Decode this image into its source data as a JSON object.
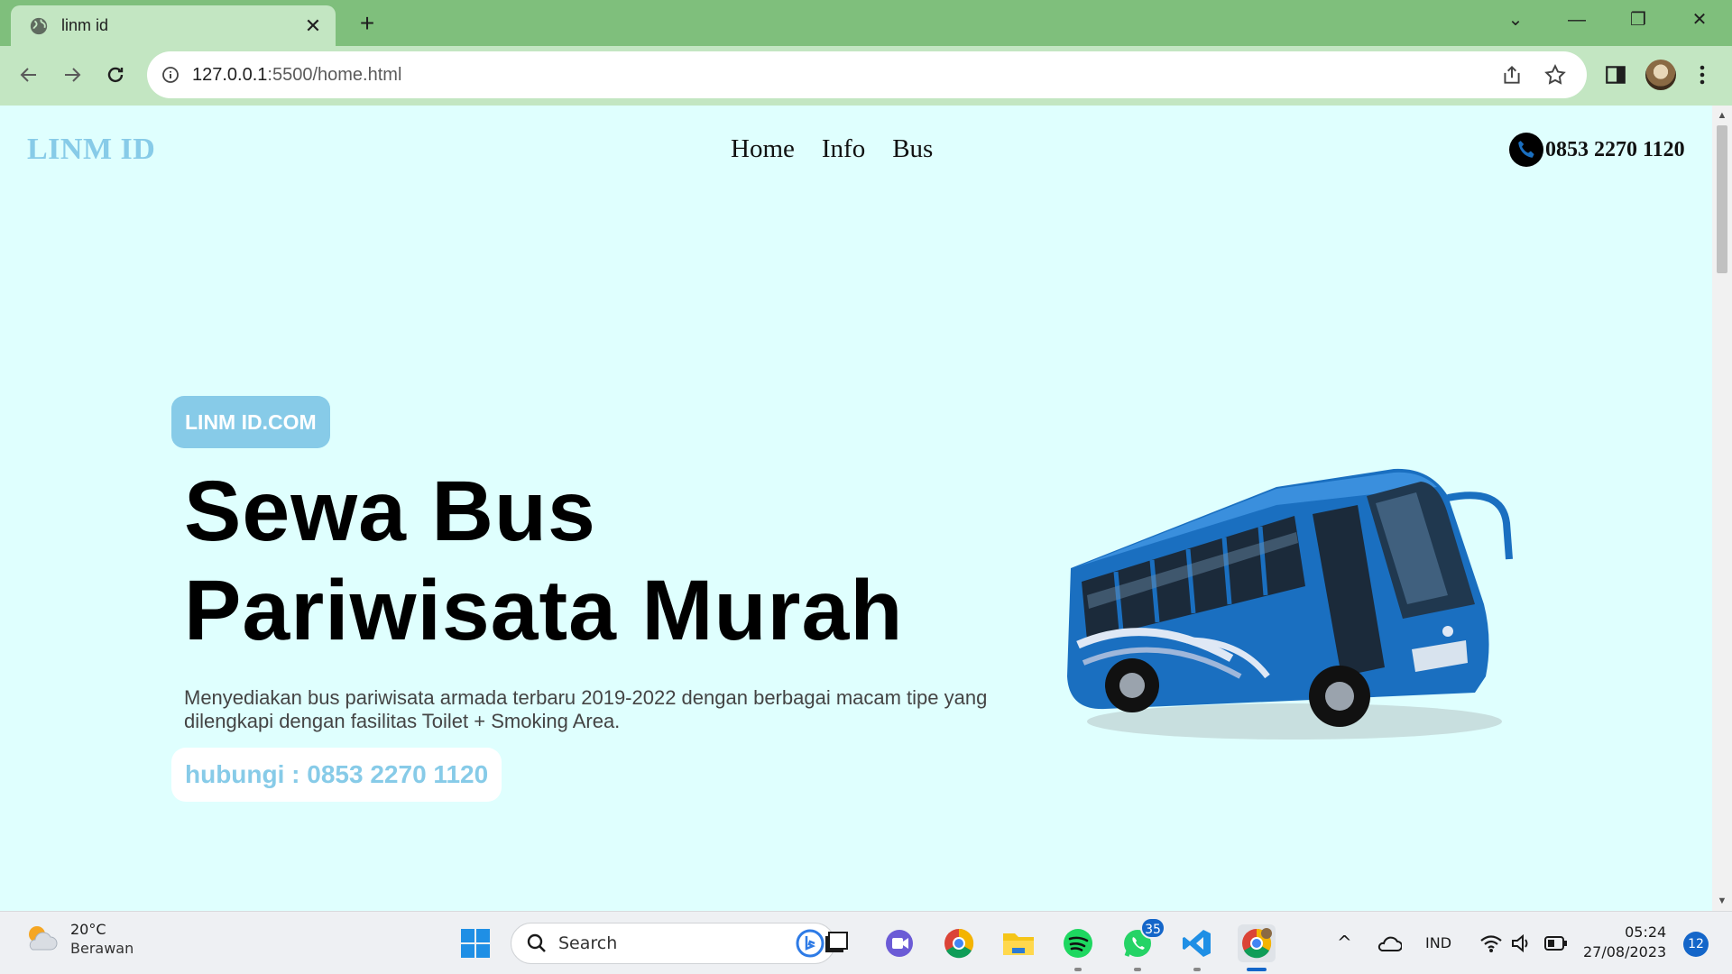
{
  "browser": {
    "tab_title": "linm id",
    "tab_close": "✕",
    "new_tab": "+",
    "url_host": "127.0.0.1",
    "url_path": ":5500/home.html",
    "window_controls": {
      "tab_search": "⌄",
      "minimize": "—",
      "restore": "❐",
      "close": "✕"
    }
  },
  "site": {
    "brand": "LINM ID",
    "nav": [
      {
        "label": "Home"
      },
      {
        "label": "Info"
      },
      {
        "label": "Bus"
      }
    ],
    "phone": "0853 2270 1120",
    "badge": "LINM ID.COM",
    "headline_line1": "Sewa Bus",
    "headline_line2": "Pariwisata Murah",
    "description": "Menyediakan bus pariwisata armada terbaru 2019-2022 dengan berbagai macam tipe yang dilengkapi dengan fasilitas Toilet + Smoking Area.",
    "cta": "hubungi : 0853 2270 1120",
    "colors": {
      "accent": "#87cbe8",
      "background": "#dffffe",
      "bus": "#1a6fc0"
    }
  },
  "taskbar": {
    "weather_temp": "20°C",
    "weather_cond": "Berawan",
    "search_placeholder": "Search",
    "whatsapp_badge": "35",
    "language": "IND",
    "time": "05:24",
    "date": "27/08/2023",
    "notifications": "12",
    "chevron": "^"
  }
}
